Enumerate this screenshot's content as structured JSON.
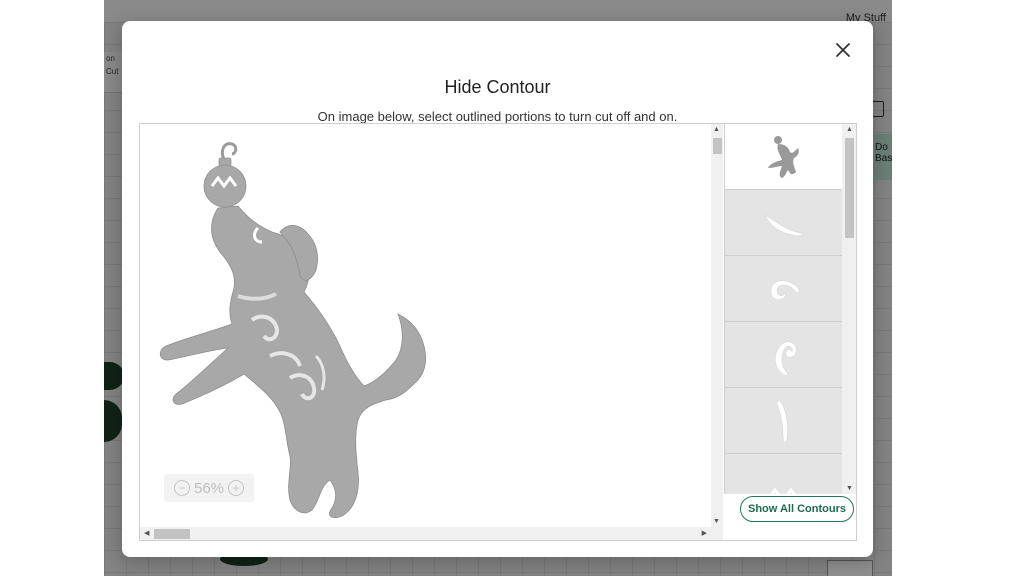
{
  "background_app": {
    "left_panel_lines": [
      "on",
      "Cut"
    ],
    "top_right_text": "My Stuff",
    "right_card_lines": [
      "Do",
      "Bas"
    ]
  },
  "modal": {
    "title": "Hide Contour",
    "subtitle": "On image below, select outlined portions to turn cut off and on.",
    "close_icon": "close-icon"
  },
  "canvas": {
    "zoom_label": "56%",
    "zoom_out_icon": "minus-circle-icon",
    "zoom_in_icon": "plus-circle-icon"
  },
  "contours": {
    "items": [
      {
        "name": "dog-silhouette",
        "selected": true
      },
      {
        "name": "swirl-1",
        "selected": false
      },
      {
        "name": "swirl-2",
        "selected": false
      },
      {
        "name": "swirl-3",
        "selected": false
      },
      {
        "name": "swirl-4",
        "selected": false
      },
      {
        "name": "ornament-zigzag",
        "selected": false
      }
    ],
    "show_all_label": "Show All Contours"
  },
  "colors": {
    "accent": "#1f7a55",
    "shape_fill": "#a8a8a8",
    "thumb_bg": "#e4e4e4"
  }
}
